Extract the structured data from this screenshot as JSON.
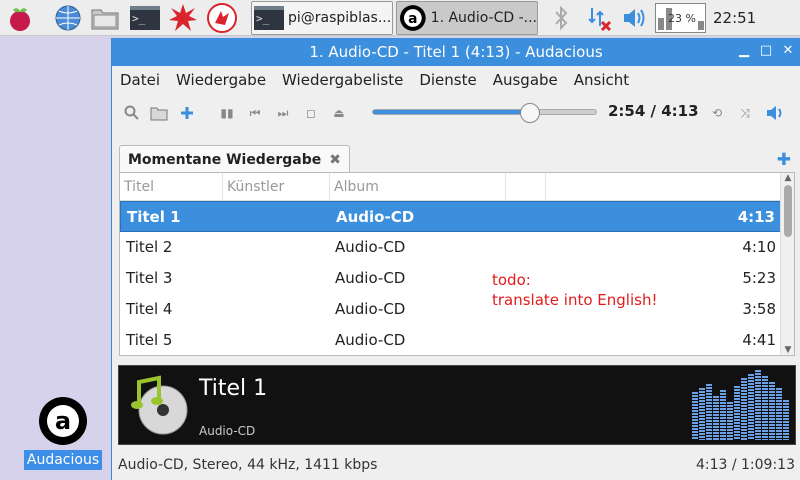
{
  "taskbar": {
    "icons": [
      "raspberry-icon",
      "globe-icon",
      "folder-icon",
      "terminal-icon",
      "burst-icon",
      "wolfram-icon"
    ],
    "tasks": [
      {
        "label": "pi@raspiblas...",
        "active": false
      },
      {
        "label": "1. Audio-CD -...",
        "active": true
      }
    ],
    "cpu": "23 %",
    "clock": "22:51"
  },
  "desktop": {
    "icon_label": "Audacious"
  },
  "window": {
    "title": "1. Audio-CD - Titel 1 (4:13) - Audacious",
    "menu": [
      "Datei",
      "Wiedergabe",
      "Wiedergabeliste",
      "Dienste",
      "Ausgabe",
      "Ansicht"
    ],
    "time": "2:54 / 4:13",
    "progress": 0.703,
    "tab_label": "Momentane Wiedergabe",
    "columns": [
      "Titel",
      "Künstler",
      "Album"
    ],
    "rows": [
      {
        "title": "Titel 1",
        "artist": "",
        "album": "Audio-CD",
        "length": "4:13",
        "selected": true
      },
      {
        "title": "Titel 2",
        "artist": "",
        "album": "Audio-CD",
        "length": "4:10",
        "selected": false
      },
      {
        "title": "Titel 3",
        "artist": "",
        "album": "Audio-CD",
        "length": "5:23",
        "selected": false
      },
      {
        "title": "Titel 4",
        "artist": "",
        "album": "Audio-CD",
        "length": "3:58",
        "selected": false
      },
      {
        "title": "Titel 5",
        "artist": "",
        "album": "Audio-CD",
        "length": "4:41",
        "selected": false
      }
    ],
    "note_line1": "todo:",
    "note_line2": "translate into English!",
    "info_title": "Titel 1",
    "info_album": "Audio-CD",
    "status_left": "Audio-CD, Stereo, 44 kHz, 1411 kbps",
    "status_right": "4:13 / 1:09:13"
  },
  "colors": {
    "accent": "#3b8fdc",
    "note": "#e21b1b"
  }
}
